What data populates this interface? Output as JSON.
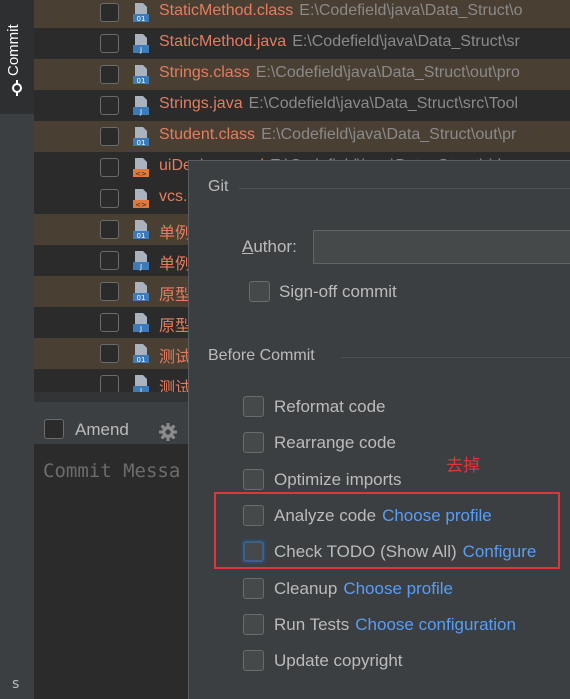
{
  "sidebar": {
    "commit_tab_label": "Commit",
    "bottom_label": "s"
  },
  "files": [
    {
      "name": "StaticMethod.class",
      "path": "E:\\Codefield\\java\\Data_Struct\\o",
      "icon": "class-file-icon",
      "modified": true
    },
    {
      "name": "StaticMethod.java",
      "path": "E:\\Codefield\\java\\Data_Struct\\sr",
      "icon": "java-file-icon",
      "modified": false
    },
    {
      "name": "Strings.class",
      "path": "E:\\Codefield\\java\\Data_Struct\\out\\pro",
      "icon": "class-file-icon",
      "modified": true
    },
    {
      "name": "Strings.java",
      "path": "E:\\Codefield\\java\\Data_Struct\\src\\Tool",
      "icon": "java-file-icon",
      "modified": false
    },
    {
      "name": "Student.class",
      "path": "E:\\Codefield\\java\\Data_Struct\\out\\pr",
      "icon": "class-file-icon",
      "modified": true
    },
    {
      "name": "uiDesigner.xml",
      "path": "E:\\Codefield\\java\\Data_Struct\\.idea",
      "icon": "xml-file-icon",
      "modified": false
    },
    {
      "name": "vcs.",
      "path": "",
      "icon": "xml-file-icon",
      "modified": false
    },
    {
      "name": "单例",
      "path": "",
      "icon": "class-file-icon",
      "modified": true
    },
    {
      "name": "单例",
      "path": "",
      "icon": "java-file-icon",
      "modified": false
    },
    {
      "name": "原型",
      "path": "",
      "icon": "class-file-icon",
      "modified": true
    },
    {
      "name": "原型",
      "path": "",
      "icon": "java-file-icon",
      "modified": false
    },
    {
      "name": "测试",
      "path": "",
      "icon": "class-file-icon",
      "modified": true
    },
    {
      "name": "测试",
      "path": "",
      "icon": "java-file-icon",
      "modified": false
    }
  ],
  "bottom": {
    "amend_label": "Amend",
    "commit_message_placeholder": "Commit Messa"
  },
  "popup": {
    "git_section": "Git",
    "author_label": "Author:",
    "author_value": "",
    "signoff_label": "Sign-off commit",
    "before_commit_section": "Before Commit",
    "options": [
      {
        "label": "Reformat code",
        "link": ""
      },
      {
        "label": "Rearrange code",
        "link": ""
      },
      {
        "label": "Optimize imports",
        "link": ""
      },
      {
        "label": "Analyze code",
        "link": "Choose profile"
      },
      {
        "label": "Check TODO (Show All)",
        "link": "Configure"
      },
      {
        "label": "Cleanup",
        "link": "Choose profile"
      },
      {
        "label": "Run Tests",
        "link": "Choose configuration"
      },
      {
        "label": "Update copyright",
        "link": ""
      }
    ]
  },
  "annotation": {
    "text": "去掉",
    "color": "#e0353b"
  },
  "colors": {
    "file_name_modified": "#e67c5f",
    "link": "#589df6",
    "background": "#2b2b2b",
    "panel": "#3c3f41"
  }
}
